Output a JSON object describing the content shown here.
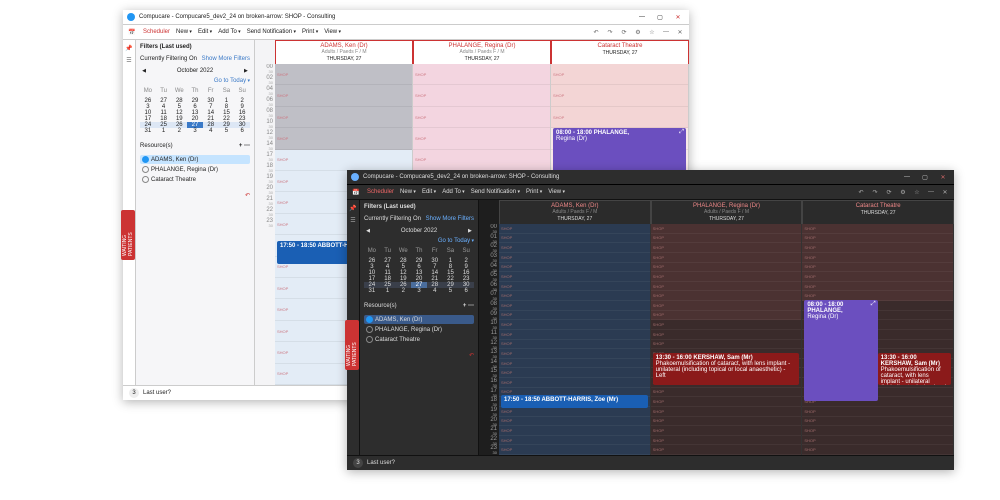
{
  "app_title": "Compucare - Compucare5_dev2_24 on broken-arrow: SHOP - Consulting",
  "menus": {
    "scheduler": "Scheduler",
    "new": "New",
    "edit": "Edit",
    "add_to": "Add To",
    "send_notification": "Send Notification",
    "print": "Print",
    "view": "View"
  },
  "sidebar": {
    "filters_header": "Filters (Last used)",
    "currently_filtering": "Currently Filtering On",
    "show_more": "Show More Filters",
    "month_label": "October 2022",
    "go_to_today": "Go to Today",
    "dows": [
      "Mo",
      "Tu",
      "We",
      "Th",
      "Fr",
      "Sa",
      "Su"
    ],
    "weeks": [
      [
        "26",
        "27",
        "28",
        "29",
        "30",
        "1",
        "2"
      ],
      [
        "3",
        "4",
        "5",
        "6",
        "7",
        "8",
        "9"
      ],
      [
        "10",
        "11",
        "12",
        "13",
        "14",
        "15",
        "16"
      ],
      [
        "17",
        "18",
        "19",
        "20",
        "21",
        "22",
        "23"
      ],
      [
        "24",
        "25",
        "26",
        "27",
        "28",
        "29",
        "30"
      ],
      [
        "31",
        "1",
        "2",
        "3",
        "4",
        "5",
        "6"
      ]
    ],
    "selected_day": "27",
    "resources_header": "Resource(s)",
    "resources": [
      {
        "label": "ADAMS, Ken (Dr)",
        "selected": true
      },
      {
        "label": "PHALANGE, Regina (Dr)",
        "selected": false
      },
      {
        "label": "Cataract Theatre",
        "selected": false
      }
    ],
    "undo": "↶"
  },
  "columns": [
    {
      "name": "ADAMS, Ken (Dr)",
      "sub": "Adults / Paeds   F / M",
      "day": "THURSDAY, 27"
    },
    {
      "name": "PHALANGE, Regina (Dr)",
      "sub": "Adults / Paeds   F / M",
      "day": "THURSDAY, 27"
    },
    {
      "name": "Cataract Theatre",
      "sub": "",
      "day": "THURSDAY, 27"
    }
  ],
  "slot_tag": "SHOP",
  "light_hours": [
    "00",
    "02",
    "04",
    "06",
    "08",
    "10",
    "12",
    "14",
    "17",
    "18",
    "19",
    "20",
    "21",
    "22",
    "23"
  ],
  "light_appts": {
    "blue": {
      "time_label": "17:50 - 18:50 ABBOTT-HARRIS, Zoe (Mr)"
    },
    "purple": {
      "time_label": "08:00 - 18:00 PHALANGE,",
      "who": "Regina (Dr)"
    }
  },
  "dark_hours": [
    "00",
    "01",
    "02",
    "03",
    "04",
    "05",
    "06",
    "07",
    "08",
    "09",
    "10",
    "11",
    "12",
    "13",
    "14",
    "15",
    "16",
    "17",
    "18",
    "19",
    "20",
    "21",
    "22",
    "23"
  ],
  "dark_appts": {
    "purple": {
      "time_label": "08:00 - 18:00 PHALANGE,",
      "who": "Regina (Dr)"
    },
    "red1": {
      "time_label": "13:30 - 16:00 KERSHAW, Sam (Mr)",
      "desc": "Phakoemulsification of cataract, with lens implant - unilateral (including topical or local anaesthetic) - Left"
    },
    "red2": {
      "time_label": "13:30 - 16:00 KERSHAW, Sam (Mr)",
      "desc": "Phakoemulsification of cataract, with lens implant - unilateral (including topical or local anaesthetic) - Left"
    },
    "blue": {
      "time_label": "17:50 - 18:50 ABBOTT-HARRIS, Zoe (Mr)"
    }
  },
  "side_tab": "WAITING PATIENTS",
  "footer": {
    "badge": "3",
    "label": "Last user?"
  }
}
